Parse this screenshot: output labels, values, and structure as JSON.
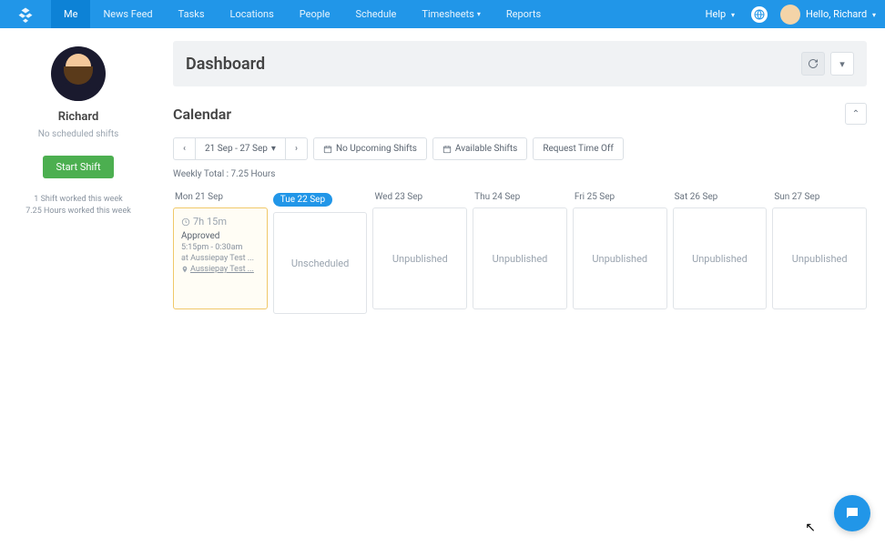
{
  "nav": {
    "items": [
      "Me",
      "News Feed",
      "Tasks",
      "Locations",
      "People",
      "Schedule",
      "Timesheets",
      "Reports"
    ]
  },
  "topbar": {
    "help": "Help",
    "hello": "Hello, Richard"
  },
  "sidebar": {
    "name": "Richard",
    "no_shifts": "No scheduled shifts",
    "start": "Start Shift",
    "stat1": "1 Shift worked this week",
    "stat2": "7.25 Hours worked this week"
  },
  "dashboard": {
    "title": "Dashboard"
  },
  "calendar": {
    "title": "Calendar",
    "date_range": "21 Sep - 27 Sep",
    "no_upcoming": "No Upcoming Shifts",
    "available": "Available Shifts",
    "request": "Request Time Off",
    "weekly_total": "Weekly Total : 7.25 Hours",
    "days": [
      {
        "label": "Mon 21 Sep",
        "active": false,
        "filled": true,
        "duration": "7h 15m",
        "status": "Approved",
        "time": "5:15pm - 0:30am",
        "location": "at Aussiepay Test ...",
        "link": "Aussiepay Test ..."
      },
      {
        "label": "Tue 22 Sep",
        "active": true,
        "filled": false,
        "text": "Unscheduled"
      },
      {
        "label": "Wed 23 Sep",
        "active": false,
        "filled": false,
        "text": "Unpublished"
      },
      {
        "label": "Thu 24 Sep",
        "active": false,
        "filled": false,
        "text": "Unpublished"
      },
      {
        "label": "Fri 25 Sep",
        "active": false,
        "filled": false,
        "text": "Unpublished"
      },
      {
        "label": "Sat 26 Sep",
        "active": false,
        "filled": false,
        "text": "Unpublished"
      },
      {
        "label": "Sun 27 Sep",
        "active": false,
        "filled": false,
        "text": "Unpublished"
      }
    ]
  }
}
